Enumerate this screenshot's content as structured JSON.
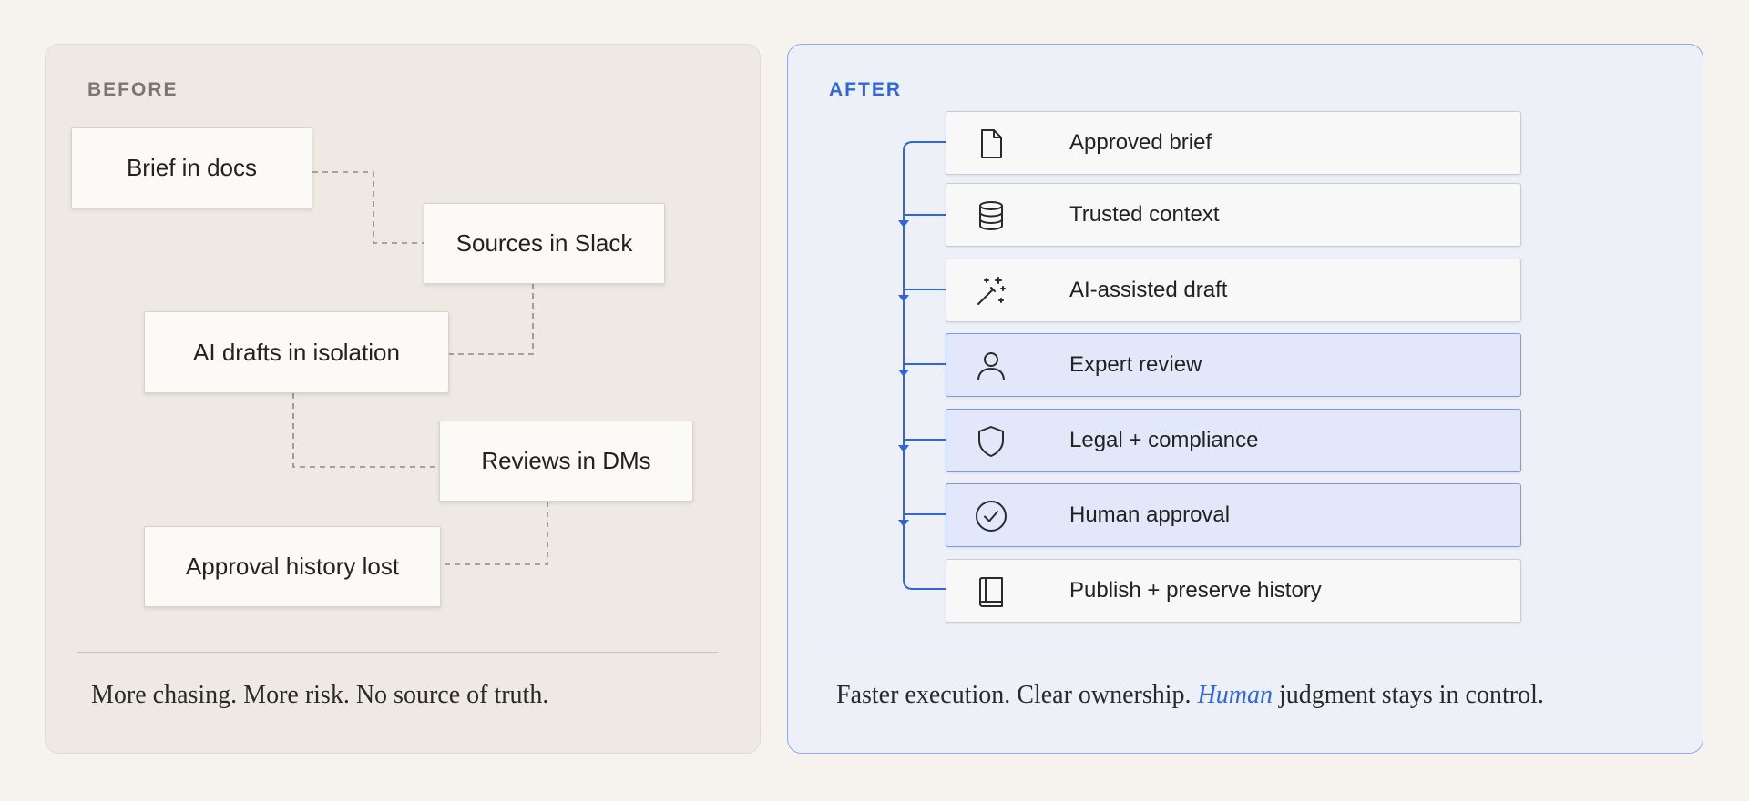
{
  "before": {
    "label": "BEFORE",
    "boxes": [
      "Brief in docs",
      "Sources in Slack",
      "AI drafts in isolation",
      "Reviews in DMs",
      "Approval history lost"
    ],
    "caption": "More chasing. More risk. No source of truth."
  },
  "after": {
    "label": "AFTER",
    "steps": [
      {
        "label": "Approved brief",
        "icon": "document-icon",
        "highlighted": false
      },
      {
        "label": "Trusted context",
        "icon": "database-icon",
        "highlighted": false
      },
      {
        "label": "AI-assisted draft",
        "icon": "magic-wand-icon",
        "highlighted": false
      },
      {
        "label": "Expert review",
        "icon": "person-icon",
        "highlighted": true
      },
      {
        "label": "Legal + compliance",
        "icon": "shield-icon",
        "highlighted": true
      },
      {
        "label": "Human approval",
        "icon": "check-circle-icon",
        "highlighted": true
      },
      {
        "label": "Publish + preserve history",
        "icon": "book-icon",
        "highlighted": false
      }
    ],
    "caption": {
      "prefix": "Faster execution. Clear ownership. ",
      "emphasis": "Human",
      "suffix": " judgment stays in control."
    }
  },
  "colors": {
    "accent": "#2f66e0",
    "before_bg": "#eee9e2",
    "after_bg": "#eef0f8",
    "highlight_bg": "#e2e8fa"
  }
}
